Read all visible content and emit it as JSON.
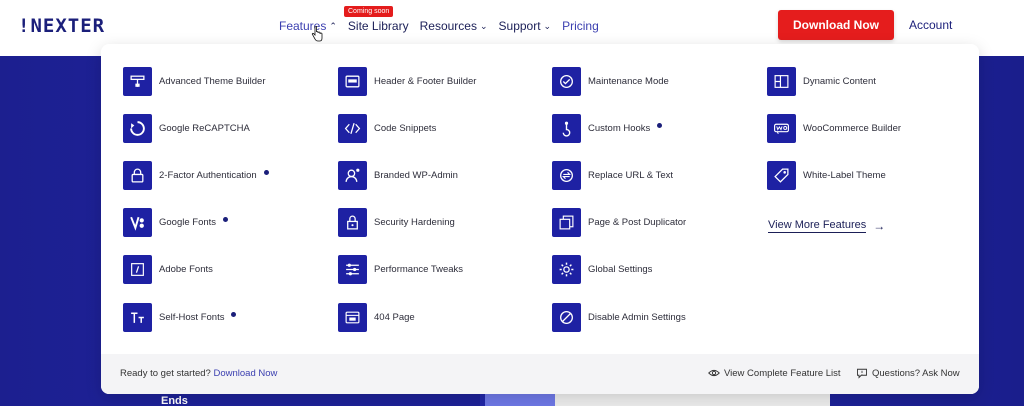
{
  "header": {
    "logo_text": "!NEXTER",
    "nav": [
      {
        "label": "Features",
        "chevron": "up"
      },
      {
        "label": "Site Library",
        "chevron": ""
      },
      {
        "label": "Resources",
        "chevron": "down"
      },
      {
        "label": "Support",
        "chevron": "down"
      },
      {
        "label": "Pricing",
        "chevron": ""
      }
    ],
    "coming_soon_badge": "Coming soon",
    "download_label": "Download Now",
    "account_label": "Account"
  },
  "colors": {
    "brand_navy": "#1e21a3",
    "cta_red": "#e51d1d",
    "link_blue": "#3b3fb0"
  },
  "features": {
    "col1": [
      {
        "label": "Advanced Theme Builder",
        "icon": "theme-builder-icon",
        "dot": false
      },
      {
        "label": "Google ReCAPTCHA",
        "icon": "recaptcha-icon",
        "dot": false
      },
      {
        "label": "2-Factor Authentication",
        "icon": "lock-icon",
        "dot": true
      },
      {
        "label": "Google Fonts",
        "icon": "google-fonts-icon",
        "dot": true
      },
      {
        "label": "Adobe Fonts",
        "icon": "adobe-fonts-icon",
        "dot": false
      },
      {
        "label": "Self-Host Fonts",
        "icon": "self-host-fonts-icon",
        "dot": true
      }
    ],
    "col2": [
      {
        "label": "Header & Footer Builder",
        "icon": "header-footer-icon",
        "dot": false
      },
      {
        "label": "Code Snippets",
        "icon": "code-icon",
        "dot": false
      },
      {
        "label": "Branded WP-Admin",
        "icon": "user-admin-icon",
        "dot": false
      },
      {
        "label": "Security Hardening",
        "icon": "padlock-icon",
        "dot": false
      },
      {
        "label": "Performance Tweaks",
        "icon": "sliders-icon",
        "dot": false
      },
      {
        "label": "404 Page",
        "icon": "404-page-icon",
        "dot": false
      }
    ],
    "col3": [
      {
        "label": "Maintenance Mode",
        "icon": "maintenance-icon",
        "dot": false
      },
      {
        "label": "Custom Hooks",
        "icon": "hook-icon",
        "dot": true
      },
      {
        "label": "Replace URL & Text",
        "icon": "replace-icon",
        "dot": false
      },
      {
        "label": "Page & Post Duplicator",
        "icon": "duplicate-icon",
        "dot": false
      },
      {
        "label": "Global Settings",
        "icon": "gear-icon",
        "dot": false
      },
      {
        "label": "Disable Admin Settings",
        "icon": "disable-icon",
        "dot": false
      }
    ],
    "col4": [
      {
        "label": "Dynamic Content",
        "icon": "dynamic-content-icon",
        "dot": false
      },
      {
        "label": "WooCommerce Builder",
        "icon": "woocommerce-icon",
        "dot": false
      },
      {
        "label": "White-Label Theme",
        "icon": "tag-icon",
        "dot": false
      }
    ],
    "view_more_label": "View More Features"
  },
  "footer": {
    "ready_text": "Ready to get started?",
    "ready_link": "Download Now",
    "feature_list_label": "View Complete Feature List",
    "questions_label": "Questions? Ask Now"
  },
  "hero": {
    "ends_label": "Ends"
  }
}
